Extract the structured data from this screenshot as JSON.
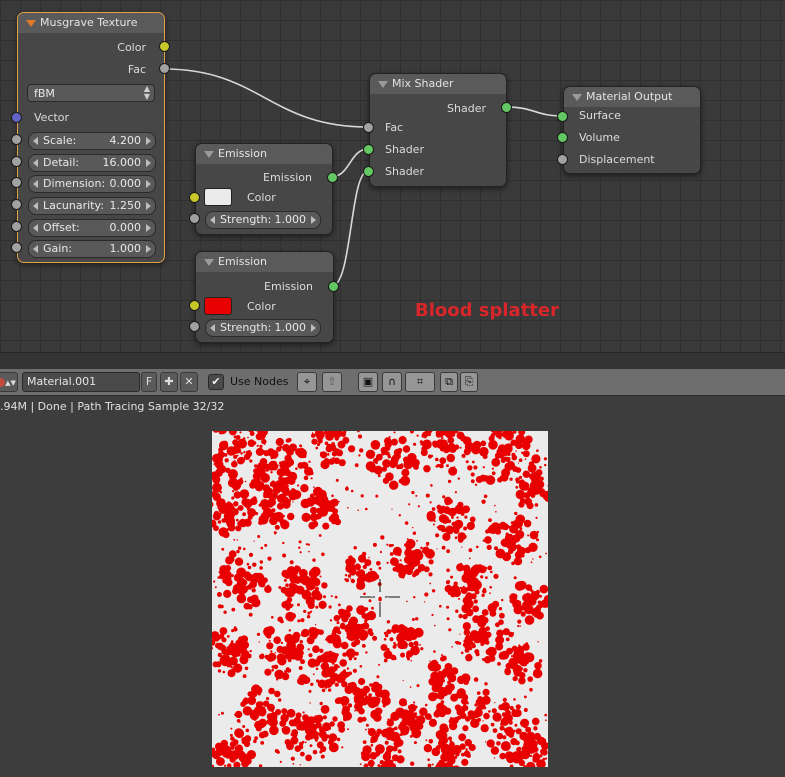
{
  "musgrave": {
    "title": "Musgrave Texture",
    "out_color": "Color",
    "out_fac": "Fac",
    "type": "fBM",
    "in_vector": "Vector",
    "params": [
      {
        "label": "Scale:",
        "value": "4.200"
      },
      {
        "label": "Detail:",
        "value": "16.000"
      },
      {
        "label": "Dimension:",
        "value": "0.000"
      },
      {
        "label": "Lacunarity:",
        "value": "1.250"
      },
      {
        "label": "Offset:",
        "value": "0.000"
      },
      {
        "label": "Gain:",
        "value": "1.000"
      }
    ]
  },
  "emission_white": {
    "title": "Emission",
    "out_emission": "Emission",
    "color_label": "Color",
    "color": "#ebebeb",
    "strength_label": "Strength:",
    "strength_value": "1.000"
  },
  "emission_red": {
    "title": "Emission",
    "out_emission": "Emission",
    "color_label": "Color",
    "color": "#e80000",
    "strength_label": "Strength:",
    "strength_value": "1.000"
  },
  "mix_shader": {
    "title": "Mix Shader",
    "out_shader": "Shader",
    "in_fac": "Fac",
    "in_shader1": "Shader",
    "in_shader2": "Shader"
  },
  "material_output": {
    "title": "Material Output",
    "in_surface": "Surface",
    "in_volume": "Volume",
    "in_displacement": "Displacement"
  },
  "annotation": "Blood splatter",
  "header": {
    "material_name": "Material.001",
    "fake_user_label": "F",
    "use_nodes_label": "Use Nodes",
    "use_nodes_checked": "✔"
  },
  "status": ".94M | Done | Path Tracing Sample 32/32",
  "colors": {
    "socket_color": "#c7c729",
    "socket_float": "#a1a1a1",
    "socket_shader": "#63c763",
    "socket_vector": "#6363c7",
    "selected_border": "#e0a047",
    "splatter_red": "#e80000",
    "splatter_background": "#ebebeb"
  }
}
